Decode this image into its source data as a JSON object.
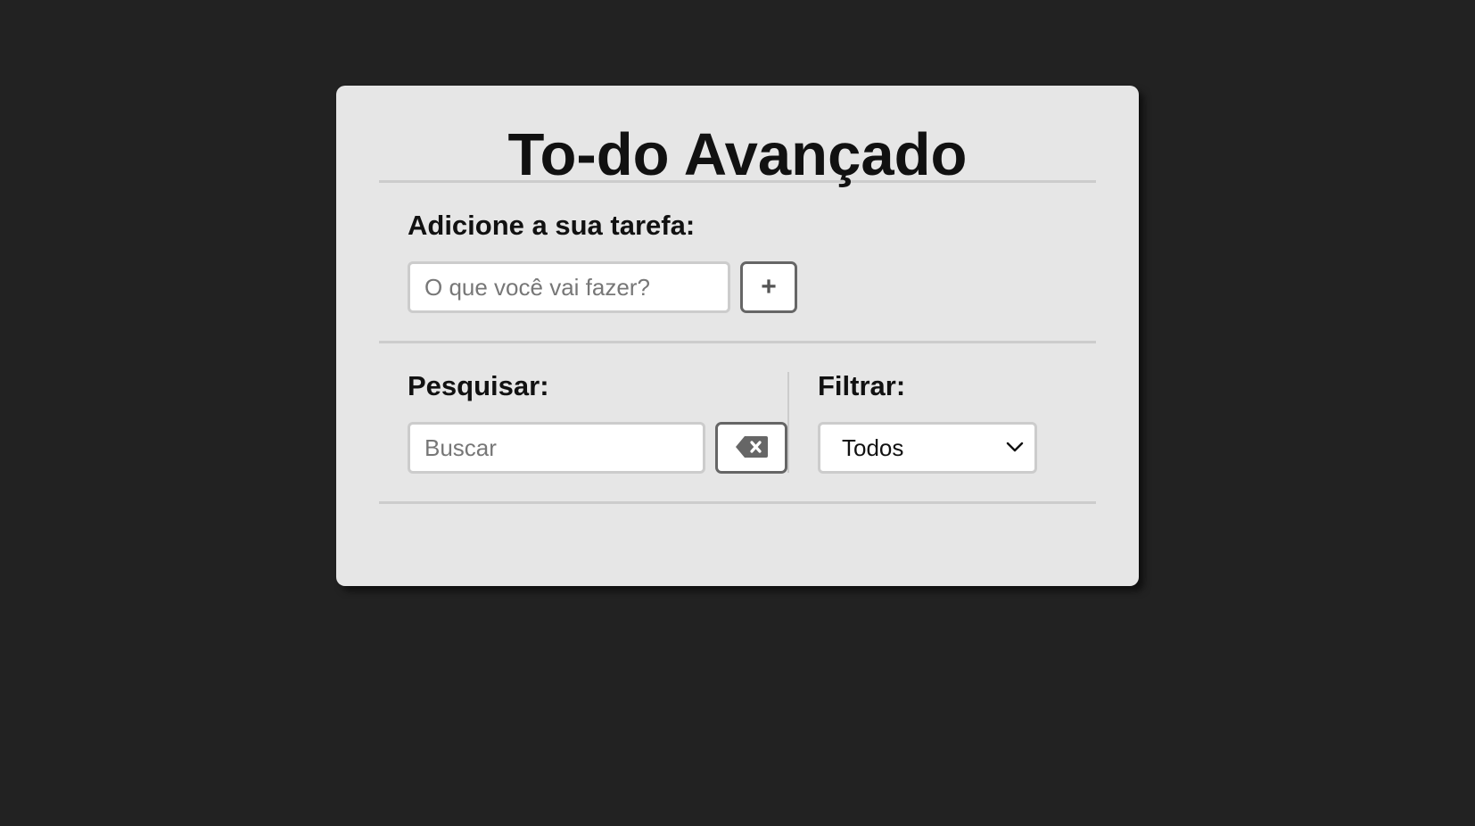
{
  "app": {
    "title": "To-do Avançado"
  },
  "add_task": {
    "label": "Adicione a sua tarefa:",
    "input_placeholder": "O que você vai fazer?",
    "input_value": "",
    "add_button_label": "+"
  },
  "search": {
    "label": "Pesquisar:",
    "placeholder": "Buscar",
    "value": "",
    "clear_icon": "backspace-icon"
  },
  "filter": {
    "label": "Filtrar:",
    "selected": "Todos",
    "chevron_icon": "chevron-down-icon"
  },
  "colors": {
    "background": "#222222",
    "card": "#e6e6e6",
    "border": "#cccccc",
    "button_border": "#666666",
    "icon": "#555555"
  }
}
